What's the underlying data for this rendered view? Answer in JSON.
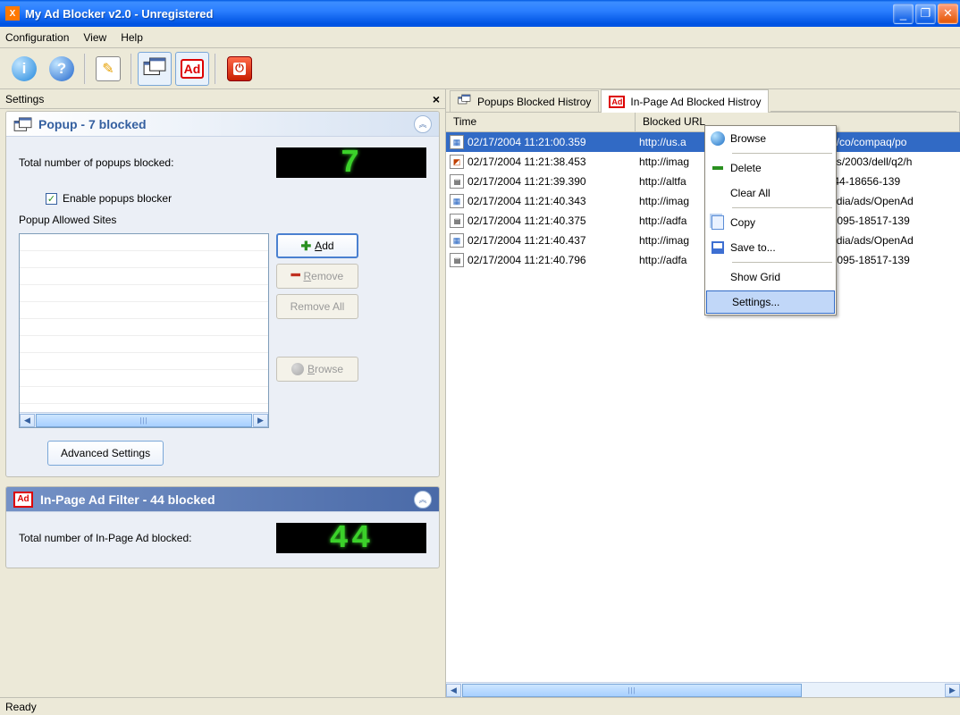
{
  "titlebar": {
    "title": "My Ad Blocker v2.0 - Unregistered"
  },
  "menubar": {
    "configuration": "Configuration",
    "view": "View",
    "help": "Help"
  },
  "left": {
    "header": "Settings",
    "popup": {
      "title": "Popup - 7 blocked",
      "total_label": "Total number of popups blocked:",
      "count": "7",
      "enable_label": "Enable popups blocker",
      "allowed_label": "Popup Allowed Sites",
      "add": "Add",
      "remove": "Remove",
      "remove_all": "Remove All",
      "browse": "Browse",
      "advanced": "Advanced Settings"
    },
    "inpage": {
      "title": "In-Page Ad Filter - 44 blocked",
      "total_label": "Total number of In-Page Ad blocked:",
      "count": "44"
    }
  },
  "right": {
    "tabs": {
      "popup": "Popups Blocked Histroy",
      "inpage": "In-Page Ad Blocked Histroy"
    },
    "headers": {
      "time": "Time",
      "url": "Blocked URL"
    },
    "rows": [
      {
        "icon": "html",
        "time": "02/17/2004 11:21:00.359",
        "url_l": "http://us.a",
        "url_r": "m/a/co/compaq/po",
        "selected": true
      },
      {
        "icon": "img",
        "time": "02/17/2004 11:21:38.453",
        "url_l": "http://imag",
        "url_r": "sors/2003/dell/q2/h"
      },
      {
        "icon": "cal",
        "time": "02/17/2004 11:21:39.390",
        "url_l": "http://altfa",
        "url_r": "/3744-18656-139"
      },
      {
        "icon": "html",
        "time": "02/17/2004 11:21:40.343",
        "url_l": "http://imag",
        "url_r": "Media/ads/OpenAd"
      },
      {
        "icon": "cal",
        "time": "02/17/2004 11:21:40.375",
        "url_l": "http://adfa",
        "url_r": "m/2095-18517-139"
      },
      {
        "icon": "html",
        "time": "02/17/2004 11:21:40.437",
        "url_l": "http://imag",
        "url_r": "Media/ads/OpenAd"
      },
      {
        "icon": "cal",
        "time": "02/17/2004 11:21:40.796",
        "url_l": "http://adfa",
        "url_r": "m/2095-18517-139"
      }
    ]
  },
  "ctx": {
    "browse": "Browse",
    "delete": "Delete",
    "clear_all": "Clear All",
    "copy": "Copy",
    "save_to": "Save to...",
    "show_grid": "Show Grid",
    "settings": "Settings..."
  },
  "statusbar": {
    "text": "Ready"
  }
}
